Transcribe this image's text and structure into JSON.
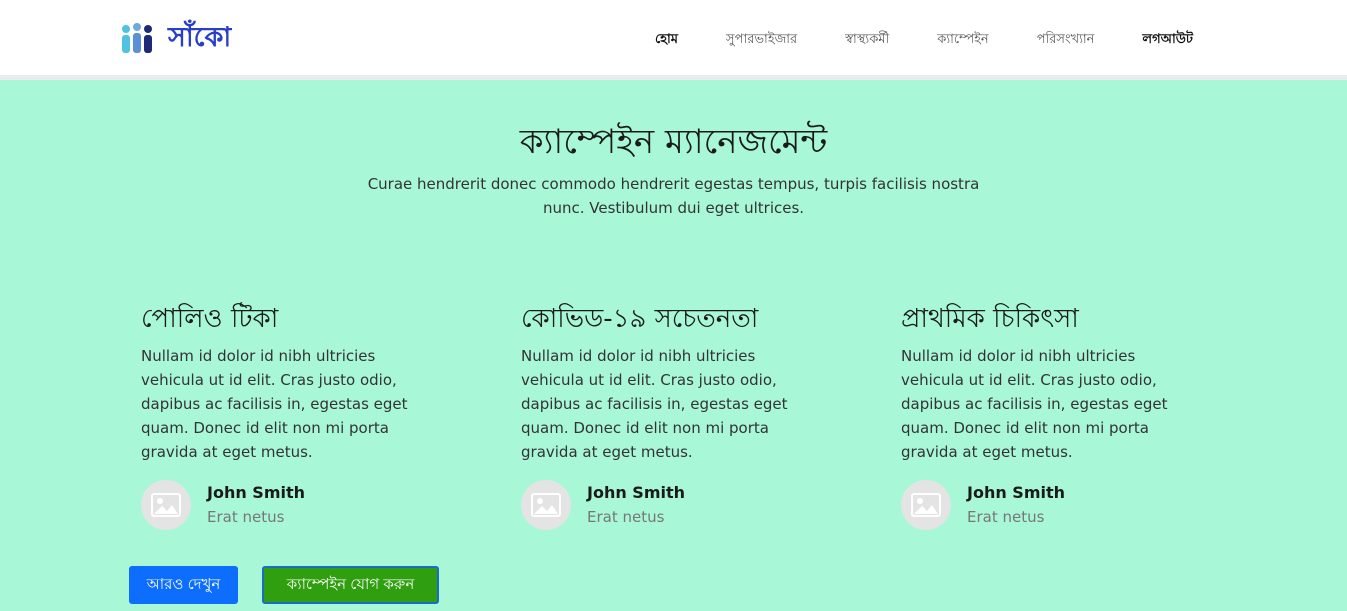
{
  "brand": {
    "name": "সাঁকো",
    "logo_icon": "people-logo-icon"
  },
  "nav": {
    "items": [
      {
        "label": "হোম"
      },
      {
        "label": "সুপারভাইজার"
      },
      {
        "label": "স্বাস্থ্যকর্মী"
      },
      {
        "label": "ক্যাম্পেইন"
      },
      {
        "label": "পরিসংখ্যান"
      },
      {
        "label": "লগআউট"
      }
    ]
  },
  "hero": {
    "title": "ক্যাম্পেইন ম্যানেজমেন্ট",
    "subtitle": "Curae hendrerit donec commodo hendrerit egestas tempus, turpis facilisis nostra nunc. Vestibulum dui eget ultrices."
  },
  "cards": [
    {
      "title": "পোলিও টিকা",
      "text": "Nullam id dolor id nibh ultricies vehicula ut id elit. Cras justo odio, dapibus ac facilisis in, egestas eget quam. Donec id elit non mi porta gravida at eget metus.",
      "person": {
        "name": "John Smith",
        "role": "Erat netus",
        "avatar_icon": "image-placeholder-icon"
      }
    },
    {
      "title": "কোভিড-১৯ সচেতনতা",
      "text": "Nullam id dolor id nibh ultricies vehicula ut id elit. Cras justo odio, dapibus ac facilisis in, egestas eget quam. Donec id elit non mi porta gravida at eget metus.",
      "person": {
        "name": "John Smith",
        "role": "Erat netus",
        "avatar_icon": "image-placeholder-icon"
      }
    },
    {
      "title": "প্রাথমিক চিকিৎসা",
      "text": "Nullam id dolor id nibh ultricies vehicula ut id elit. Cras justo odio, dapibus ac facilisis in, egestas eget quam. Donec id elit non mi porta gravida at eget metus.",
      "person": {
        "name": "John Smith",
        "role": "Erat netus",
        "avatar_icon": "image-placeholder-icon"
      }
    }
  ],
  "actions": {
    "more_label": "আরও দেখুন",
    "add_campaign_label": "ক্যাম্পেইন যোগ করুন"
  },
  "colors": {
    "background": "#a8f8d8",
    "brand": "#2a3fc9",
    "primary_button": "#0d6efd",
    "success_button": "#2f9e0f"
  }
}
